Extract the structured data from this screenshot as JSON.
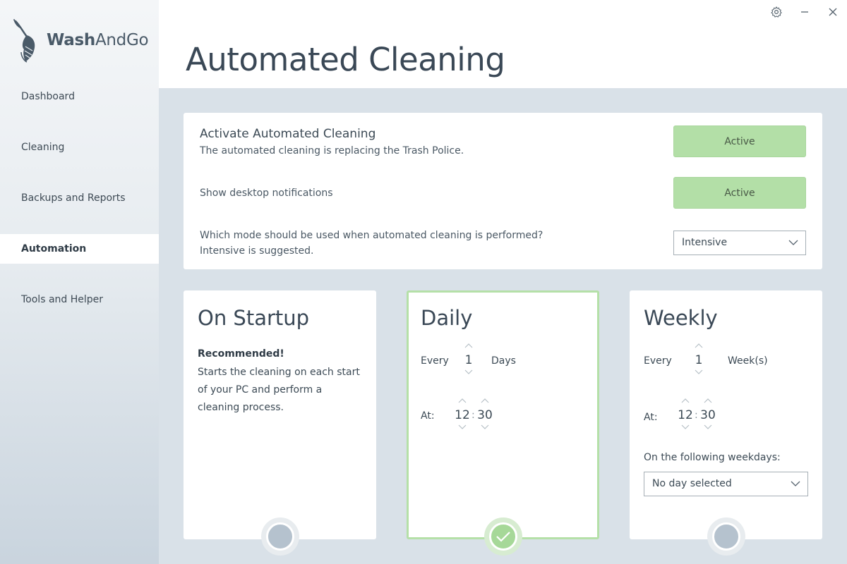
{
  "app": {
    "logo_text_bold": "Wash",
    "logo_text_rest": "AndGo"
  },
  "sidebar": {
    "items": [
      {
        "label": "Dashboard"
      },
      {
        "label": "Cleaning"
      },
      {
        "label": "Backups and Reports"
      },
      {
        "label": "Automation",
        "active": true
      },
      {
        "label": "Tools and Helper"
      }
    ]
  },
  "window_controls": {
    "icons": [
      "gear-icon",
      "minimize-icon",
      "close-icon"
    ]
  },
  "header": {
    "title": "Automated Cleaning"
  },
  "settings": {
    "activate_title": "Activate Automated Cleaning",
    "activate_desc": "The automated cleaning is replacing the Trash Police.",
    "activate_button": "Active",
    "notifications_label": "Show desktop notifications",
    "notifications_button": "Active",
    "mode_question": "Which mode should be used when automated cleaning is performed?",
    "mode_hint": "Intensive is suggested.",
    "mode_selected": "Intensive"
  },
  "modes": {
    "startup": {
      "title": "On Startup",
      "recommended": "Recommended!",
      "description": "Starts the cleaning on each start of your PC and perform a cleaning process.",
      "selected": false
    },
    "daily": {
      "title": "Daily",
      "every_label": "Every",
      "every_value": "1",
      "unit": "Days",
      "at_label": "At:",
      "hour": "12",
      "separator": ":",
      "minute": "30",
      "selected": true
    },
    "weekly": {
      "title": "Weekly",
      "every_label": "Every",
      "every_value": "1",
      "unit": "Week(s)",
      "at_label": "At:",
      "hour": "12",
      "separator": ":",
      "minute": "30",
      "weekdays_label": "On the following weekdays:",
      "weekdays_selected": "No day selected",
      "selected": false
    }
  },
  "colors": {
    "accent_green": "#b3dfa7",
    "selected_border": "#b5e0a8",
    "background": "#d9e1e8"
  }
}
